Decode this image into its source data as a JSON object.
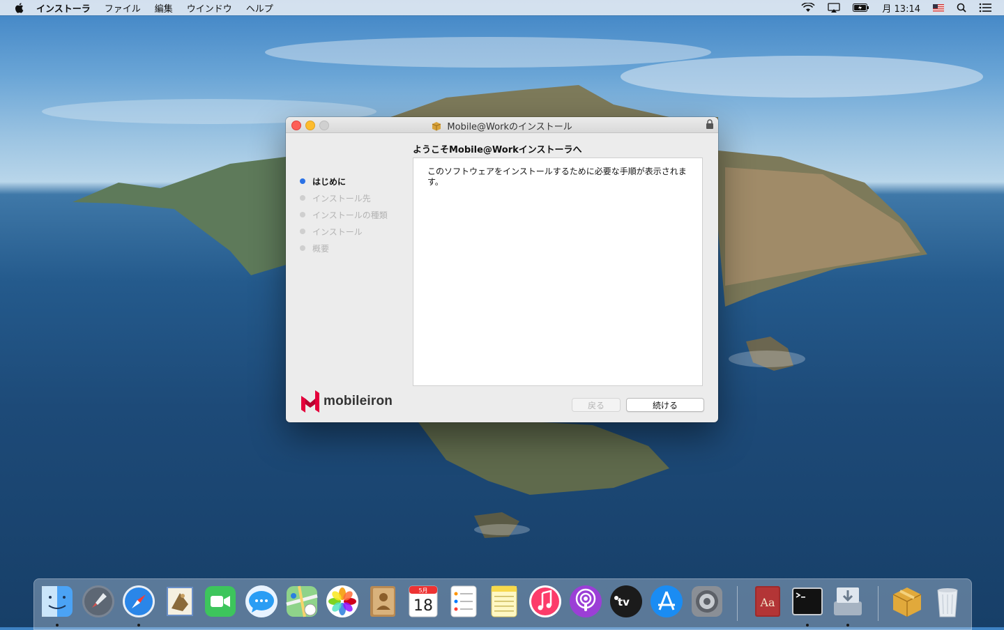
{
  "menubar": {
    "app_name": "インストーラ",
    "items": [
      "ファイル",
      "編集",
      "ウインドウ",
      "ヘルプ"
    ],
    "clock": "月 13:14",
    "icons": [
      "apple-icon",
      "wifi-icon",
      "airplay-icon",
      "battery-icon",
      "flag-us-icon",
      "spotlight-icon",
      "control-center-icon"
    ]
  },
  "window": {
    "title": "Mobile@Workのインストール",
    "subtitle": "ようこそMobile@Workインストーラへ",
    "steps": [
      {
        "label": "はじめに",
        "active": true
      },
      {
        "label": "インストール先",
        "active": false
      },
      {
        "label": "インストールの種類",
        "active": false
      },
      {
        "label": "インストール",
        "active": false
      },
      {
        "label": "概要",
        "active": false
      }
    ],
    "body_text": "このソフトウェアをインストールするために必要な手順が表示されます。",
    "logo_text": "mobileiron",
    "buttons": {
      "back": "戻る",
      "continue": "続ける"
    }
  },
  "dock": {
    "apps": [
      "finder",
      "launchpad",
      "safari",
      "mail",
      "facetime",
      "messages",
      "maps",
      "photos",
      "contacts",
      "calendar",
      "reminders",
      "notes",
      "music",
      "podcasts",
      "tv",
      "app-store",
      "system-preferences",
      "dictionary",
      "terminal",
      "downloads",
      "installer",
      "trash"
    ],
    "calendar": {
      "month": "5月",
      "day": "18"
    },
    "tv_label": "tv"
  },
  "colors": {
    "accent": "#2b72e6",
    "mobileiron_red": "#e4003b",
    "close": "#fd5f57",
    "minimize": "#fdbc2e"
  }
}
